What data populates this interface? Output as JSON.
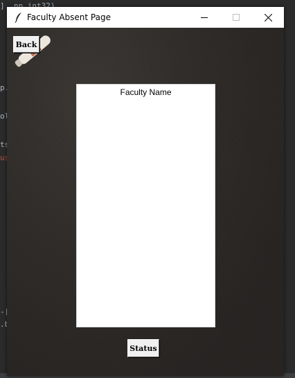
{
  "window": {
    "title": "Faculty Absent Page",
    "icon": "feather-icon"
  },
  "controls": {
    "minimize": "minimize-icon",
    "maximize": "maximize-icon",
    "close": "close-icon"
  },
  "buttons": {
    "back_label": "Back",
    "status_label": "Status"
  },
  "list": {
    "header": "Faculty Name",
    "items": []
  },
  "background_code": {
    "line1": "]  np.int32)",
    "line2": "p.",
    "line3": "ol",
    "line4": "ts",
    "line5": "us",
    "line6": "-[",
    "line7": ".b"
  },
  "colors": {
    "content_bg": "#2a2725",
    "list_bg": "#ffffff",
    "button_bg": "#f0f0f0"
  }
}
